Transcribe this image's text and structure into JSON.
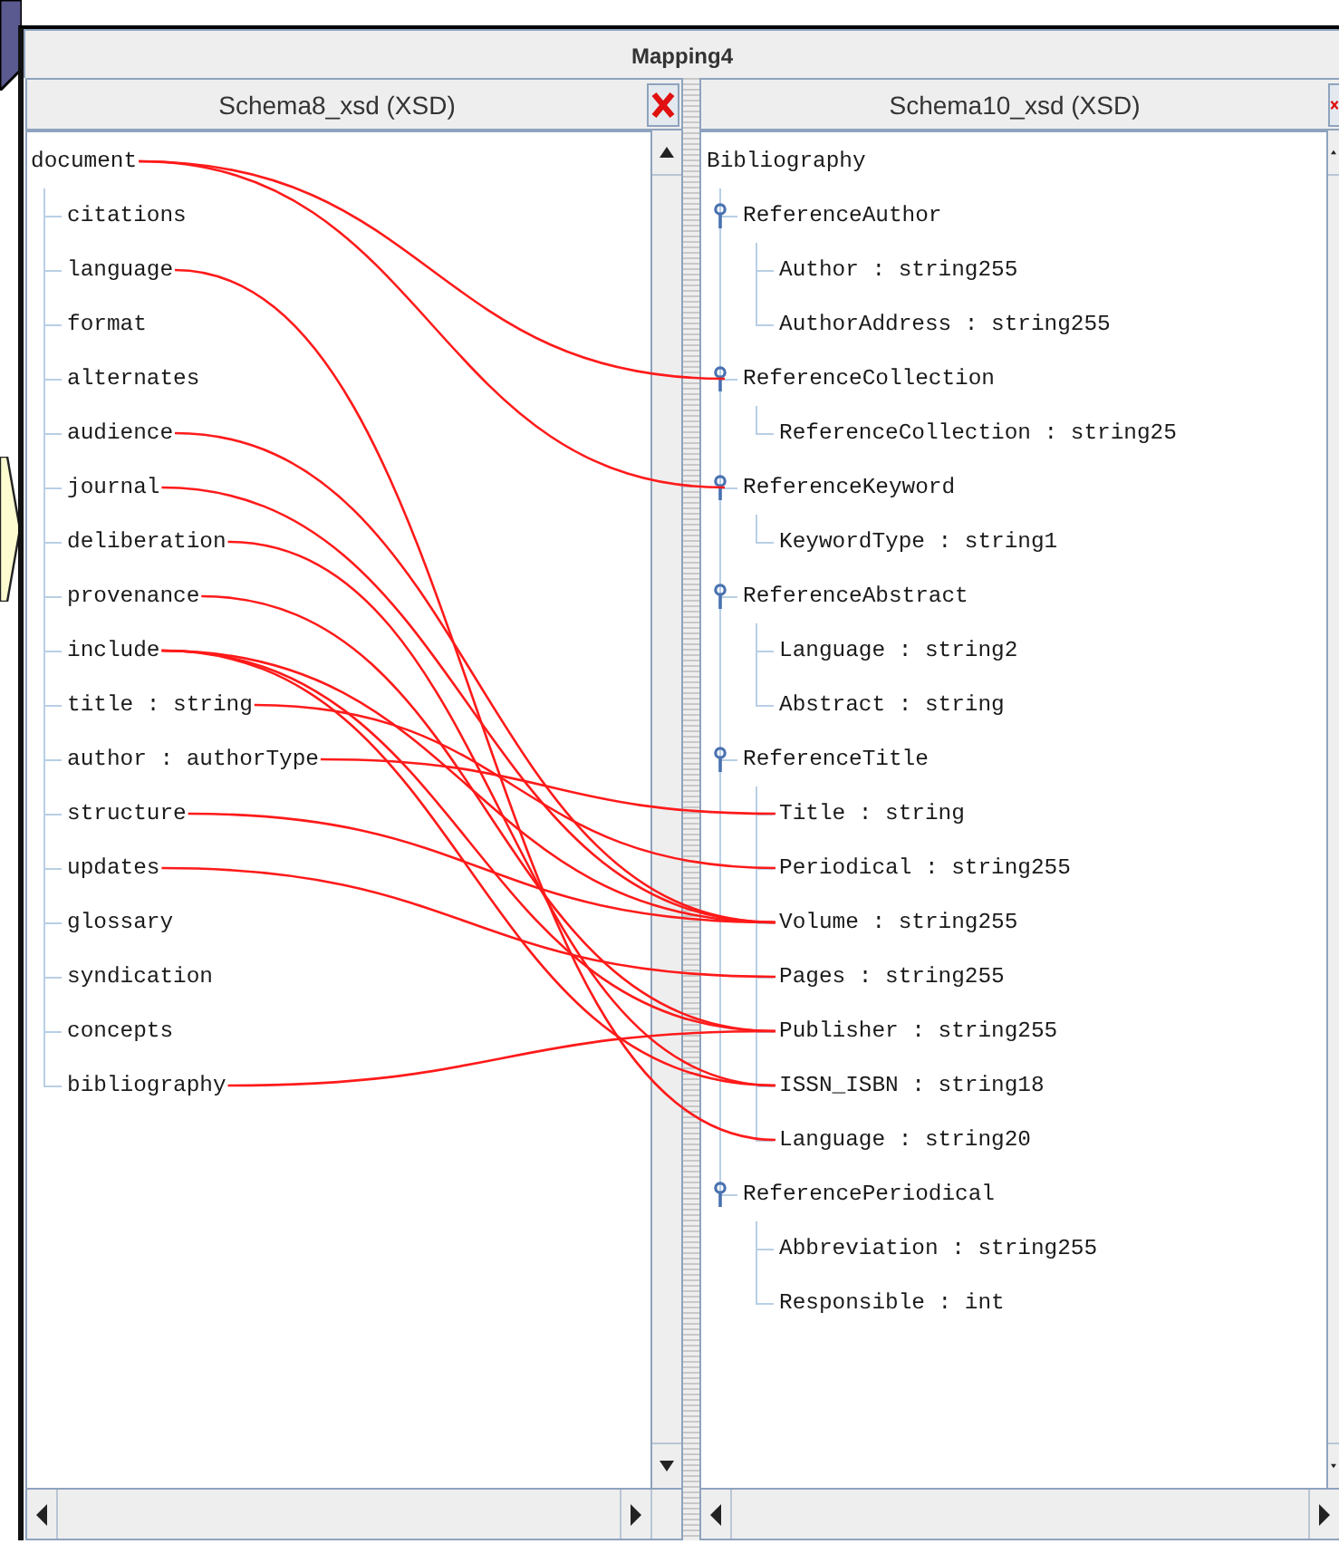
{
  "window": {
    "title": "Mapping4"
  },
  "panels": [
    {
      "title": "Schema8_xsd (XSD)",
      "tree": {
        "label": "document",
        "children": [
          {
            "label": "citations"
          },
          {
            "label": "language"
          },
          {
            "label": "format"
          },
          {
            "label": "alternates"
          },
          {
            "label": "audience"
          },
          {
            "label": "journal"
          },
          {
            "label": "deliberation"
          },
          {
            "label": "provenance"
          },
          {
            "label": "include"
          },
          {
            "label": "title : string"
          },
          {
            "label": "author : authorType"
          },
          {
            "label": "structure"
          },
          {
            "label": "updates"
          },
          {
            "label": "glossary"
          },
          {
            "label": "syndication"
          },
          {
            "label": "concepts"
          },
          {
            "label": "bibliography"
          }
        ]
      }
    },
    {
      "title": "Schema10_xsd (XSD)",
      "tree": {
        "label": "Bibliography",
        "children": [
          {
            "label": "ReferenceAuthor",
            "expanded": true,
            "children": [
              {
                "label": "Author : string255"
              },
              {
                "label": "AuthorAddress : string255"
              }
            ]
          },
          {
            "label": "ReferenceCollection",
            "expanded": true,
            "children": [
              {
                "label": "ReferenceCollection : string25"
              }
            ]
          },
          {
            "label": "ReferenceKeyword",
            "expanded": true,
            "children": [
              {
                "label": "KeywordType : string1"
              }
            ]
          },
          {
            "label": "ReferenceAbstract",
            "expanded": true,
            "children": [
              {
                "label": "Language : string2"
              },
              {
                "label": "Abstract : string"
              }
            ]
          },
          {
            "label": "ReferenceTitle",
            "expanded": true,
            "children": [
              {
                "label": "Title : string"
              },
              {
                "label": "Periodical : string255"
              },
              {
                "label": "Volume : string255"
              },
              {
                "label": "Pages : string255"
              },
              {
                "label": "Publisher : string255"
              },
              {
                "label": "ISSN_ISBN : string18"
              },
              {
                "label": "Language : string20"
              }
            ]
          },
          {
            "label": "ReferencePeriodical",
            "expanded": true,
            "children": [
              {
                "label": "Abbreviation : string255"
              },
              {
                "label": "Responsible : int"
              }
            ]
          }
        ]
      }
    }
  ]
}
